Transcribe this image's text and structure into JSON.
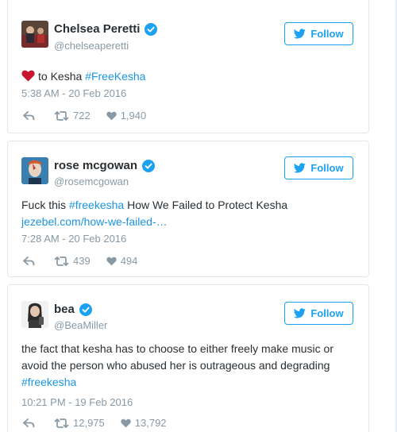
{
  "tweets": [
    {
      "name": "Chelsea Peretti",
      "handle": "@chelseaperetti",
      "follow_label": "Follow",
      "text_after_heart": "to Kesha",
      "link": "#FreeKesha",
      "timestamp": "5:38 AM - 20 Feb 2016",
      "retweets": "722",
      "likes": "1,940"
    },
    {
      "name": "rose mcgowan",
      "handle": "@rosemcgowan",
      "follow_label": "Follow",
      "text_before_link": "Fuck this",
      "link": "#freekesha",
      "text_after_link": "How We Failed to Protect Kesha",
      "url": "jezebel.com/how-we-failed-…",
      "timestamp": "7:28 AM - 20 Feb 2016",
      "retweets": "439",
      "likes": "494"
    },
    {
      "name": "bea",
      "handle": "@BeaMiller",
      "follow_label": "Follow",
      "text": "the fact that kesha has to choose to either freely make music or avoid the person who abused her is outrageous and degrading",
      "link": "#freekesha",
      "timestamp": "10:21 PM - 19 Feb 2016",
      "retweets": "12,975",
      "likes": "13,792"
    }
  ],
  "colors": {
    "accent": "#1da1f2",
    "link": "#1b95e0",
    "muted": "#8899a6",
    "heart_emoji": "#c7152e"
  },
  "icons": [
    "twitter-bird-icon",
    "verified-badge-icon",
    "reply-icon",
    "retweet-icon",
    "like-heart-icon",
    "red-heart-emoji"
  ]
}
